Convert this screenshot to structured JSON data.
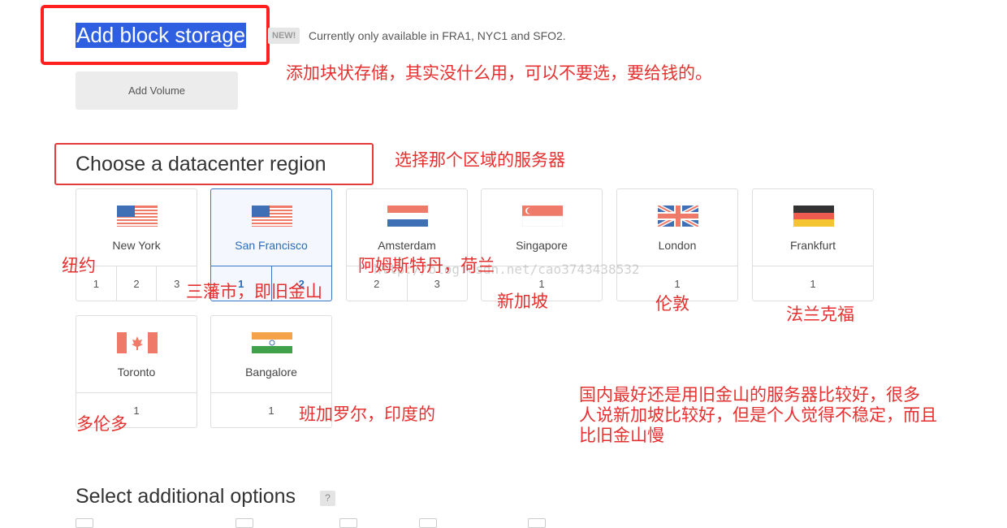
{
  "block_storage": {
    "title": "Add block storage",
    "badge": "NEW!",
    "availability_note": "Currently only available in FRA1, NYC1 and SFO2.",
    "add_volume_label": "Add Volume"
  },
  "datacenter": {
    "title": "Choose a datacenter region",
    "regions": [
      {
        "name": "New York",
        "flag": "us-flag-icon",
        "slots": [
          "1",
          "2",
          "3"
        ],
        "selected": false
      },
      {
        "name": "San Francisco",
        "flag": "us-flag-icon",
        "slots": [
          "1",
          "2"
        ],
        "selected": true
      },
      {
        "name": "Amsterdam",
        "flag": "netherlands-flag-icon",
        "slots": [
          "2",
          "3"
        ],
        "selected": false
      },
      {
        "name": "Singapore",
        "flag": "singapore-flag-icon",
        "slots": [
          "1"
        ],
        "selected": false
      },
      {
        "name": "London",
        "flag": "uk-flag-icon",
        "slots": [
          "1"
        ],
        "selected": false
      },
      {
        "name": "Frankfurt",
        "flag": "germany-flag-icon",
        "slots": [
          "1"
        ],
        "selected": false
      },
      {
        "name": "Toronto",
        "flag": "canada-flag-icon",
        "slots": [
          "1"
        ],
        "selected": false
      },
      {
        "name": "Bangalore",
        "flag": "india-flag-icon",
        "slots": [
          "1"
        ],
        "selected": false
      }
    ]
  },
  "options": {
    "title": "Select additional options",
    "help_label": "?"
  },
  "annotations": {
    "block_storage": "添加块状存储，其实没什么用，可以不要选，要给钱的。",
    "region": "选择那个区域的服务器",
    "new_york": "纽约",
    "san_francisco": "三藩市，即旧金山",
    "amsterdam": "阿姆斯特丹，荷兰",
    "singapore": "新加坡",
    "london": "伦敦",
    "frankfurt": "法兰克福",
    "toronto": "多伦多",
    "bangalore": "班加罗尔，印度的",
    "advice": [
      "国内最好还是用旧金山的服务器比较好，很多",
      "人说新加坡比较好，但是个人觉得不稳定，而且",
      "比旧金山慢"
    ]
  },
  "watermark": "http://blog.csdn.net/cao3743438532",
  "colors": {
    "annotation_red": "#e53030",
    "selection_blue": "#3a76c4",
    "title_highlight": "#2d5fe0"
  }
}
